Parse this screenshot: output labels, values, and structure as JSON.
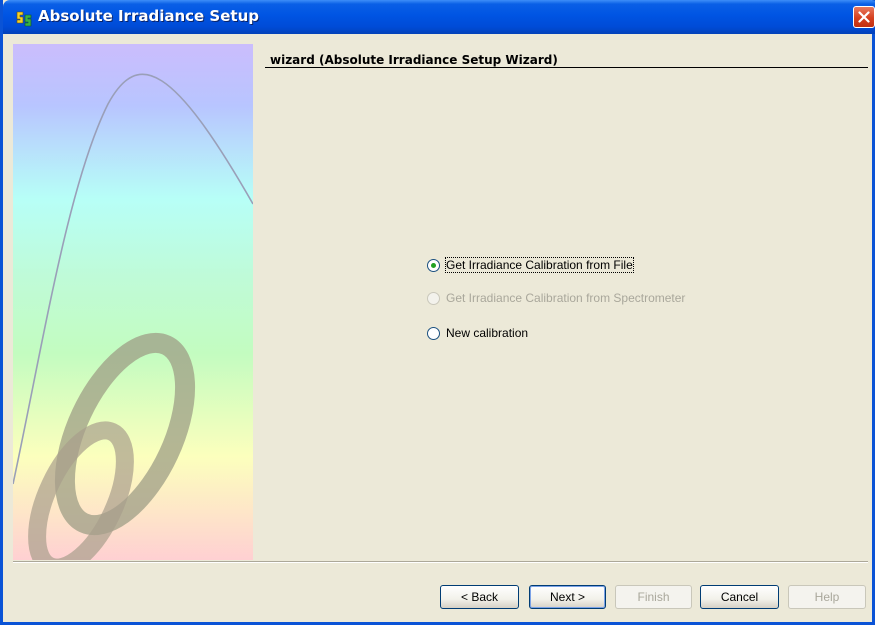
{
  "window": {
    "title": "Absolute Irradiance Setup"
  },
  "titlebar": {
    "app_icon": "spectrasuite-app-icon",
    "close_icon": "close-x-icon",
    "close_color": "#d5401f"
  },
  "side_panel": {
    "image": "spectrum-curve-omega-logo",
    "colors": [
      "#cbbdfd",
      "#b7fff7",
      "#c3fcc0",
      "#fcffbd",
      "#ffd0d2"
    ]
  },
  "header": {
    "title": "wizard (Absolute Irradiance Setup Wizard)"
  },
  "options": [
    {
      "label": "Get Irradiance Calibration from File",
      "selected": true,
      "enabled": true
    },
    {
      "label": "Get Irradiance Calibration from Spectrometer",
      "selected": false,
      "enabled": false
    },
    {
      "label": "New calibration",
      "selected": false,
      "enabled": true
    }
  ],
  "buttons": {
    "back": "< Back",
    "next": "Next >",
    "finish": "Finish",
    "cancel": "Cancel",
    "help": "Help"
  }
}
